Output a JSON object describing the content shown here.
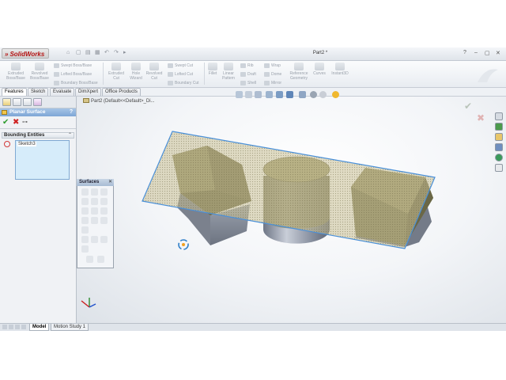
{
  "app": {
    "logo_text": "SolidWorks",
    "document_title": "Part2 *",
    "quick_access": [
      "⌂",
      "▢",
      "▤",
      "▦",
      "↶",
      "↷",
      "▸"
    ],
    "window_controls": [
      "?",
      "–",
      "▢",
      "✕"
    ]
  },
  "command_manager": {
    "large_commands": [
      {
        "label": "Extruded\nBoss/Base"
      },
      {
        "label": "Revolved\nBoss/Base"
      },
      {
        "label": "Extruded\nCut"
      },
      {
        "label": "Hole\nWizard"
      },
      {
        "label": "Revolved\nCut"
      },
      {
        "label": "Fillet"
      },
      {
        "label": "Linear\nPattern"
      },
      {
        "label": "Reference\nGeometry"
      },
      {
        "label": "Curves"
      },
      {
        "label": "Instant3D"
      }
    ],
    "small_commands": [
      {
        "label": "Swept Boss/Base"
      },
      {
        "label": "Lofted Boss/Base"
      },
      {
        "label": "Boundary Boss/Base"
      },
      {
        "label": "Swept Cut"
      },
      {
        "label": "Lofted Cut"
      },
      {
        "label": "Boundary Cut"
      },
      {
        "label": "Rib"
      },
      {
        "label": "Draft"
      },
      {
        "label": "Shell"
      },
      {
        "label": "Wrap"
      },
      {
        "label": "Dome"
      },
      {
        "label": "Mirror"
      }
    ]
  },
  "tabs": [
    "Features",
    "Sketch",
    "Evaluate",
    "DimXpert",
    "Office Products"
  ],
  "active_tab": "Features",
  "breadcrumb": "Part2 (Default<<Default>_Di...",
  "property_manager": {
    "title": "Planar Surface",
    "help": "?",
    "ok": "✔",
    "cancel": "✖",
    "pin": "⊶",
    "group_title": "Bounding Entities",
    "group_chevron": "⌃",
    "selection_items": [
      "Sketch3"
    ]
  },
  "surfaces_toolbar": {
    "title": "Surfaces",
    "close": "✕"
  },
  "confirmation_corner": {
    "ok": "✔",
    "cancel": "✖"
  },
  "bottom_tabs": [
    "Model",
    "Motion Study 1"
  ],
  "active_bottom_tab": "Model",
  "colors": {
    "accent_blue": "#7ea6d6",
    "face_olive": "#8c8a62",
    "plane_fill": "#c9c096",
    "plane_edge": "#4a90d9",
    "ok_green": "#2e9c2e",
    "cancel_red": "#cf2222"
  },
  "icons": {
    "hud": [
      "zoom-to-fit-icon",
      "zoom-area-icon",
      "previous-view-icon",
      "section-view-icon",
      "view-orientation-icon",
      "display-style-icon",
      "hide-show-icon",
      "edit-appearance-icon",
      "apply-scene-icon",
      "view-settings-icon"
    ],
    "task_pane": [
      "resources-icon",
      "design-library-icon",
      "file-explorer-icon",
      "view-palette-icon",
      "appearances-icon",
      "custom-properties-icon"
    ]
  }
}
